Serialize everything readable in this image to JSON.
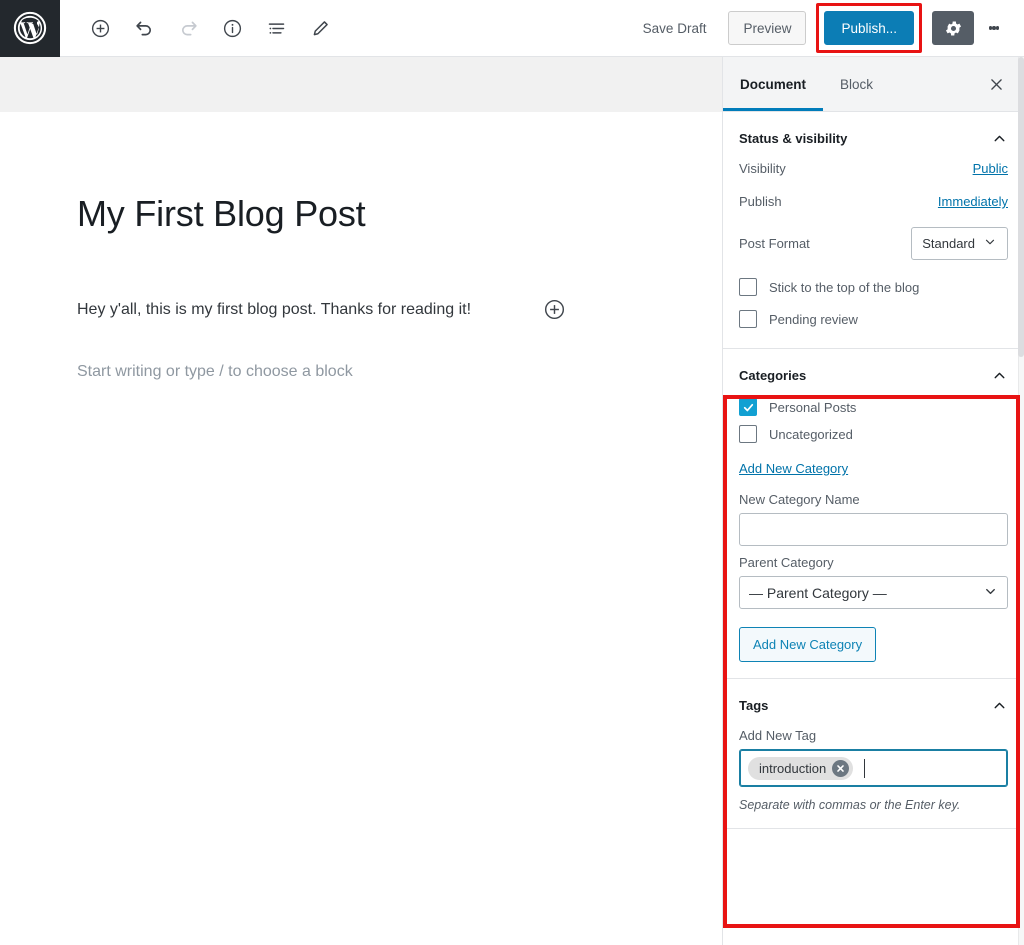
{
  "toolbar": {
    "logo_icon": "wordpress-logo-icon",
    "add_block_label": "Add block",
    "undo_label": "Undo",
    "redo_label": "Redo",
    "info_label": "Content structure",
    "list_view_label": "List view",
    "edit_label": "Edit",
    "save_draft_label": "Save Draft",
    "preview_label": "Preview",
    "publish_label": "Publish...",
    "settings_label": "Settings",
    "more_label": "More tools & options"
  },
  "editor": {
    "title": "My First Blog Post",
    "paragraph": "Hey y'all, this is my first blog post. Thanks for reading it!",
    "placeholder": "Start writing or type / to choose a block",
    "inserter_label": "Add block"
  },
  "sidebar": {
    "tabs": [
      {
        "label": "Document",
        "active": true
      },
      {
        "label": "Block",
        "active": false
      }
    ],
    "close_label": "Close settings",
    "status_panel": {
      "title": "Status & visibility",
      "visibility_label": "Visibility",
      "visibility_value": "Public",
      "publish_label": "Publish",
      "publish_value": "Immediately",
      "post_format_label": "Post Format",
      "post_format_value": "Standard",
      "sticky_label": "Stick to the top of the blog",
      "sticky_checked": false,
      "pending_label": "Pending review",
      "pending_checked": false
    },
    "categories_panel": {
      "title": "Categories",
      "items": [
        {
          "label": "Personal Posts",
          "checked": true
        },
        {
          "label": "Uncategorized",
          "checked": false
        }
      ],
      "add_new_link": "Add New Category",
      "new_name_label": "New Category Name",
      "new_name_value": "",
      "parent_label": "Parent Category",
      "parent_value": "— Parent Category —",
      "add_button_label": "Add New Category"
    },
    "tags_panel": {
      "title": "Tags",
      "add_tag_label": "Add New Tag",
      "tokens": [
        "introduction"
      ],
      "help_text": "Separate with commas or the Enter key."
    }
  },
  "annotations": {
    "publish_highlight_color": "#e81313",
    "categories_tags_highlight_color": "#e81313"
  },
  "colors": {
    "wp_blue": "#0c7db5",
    "link_blue": "#0073aa",
    "checkbox_blue": "#11a0d2",
    "admin_dark": "#23282d",
    "gear_gray": "#555d66"
  }
}
